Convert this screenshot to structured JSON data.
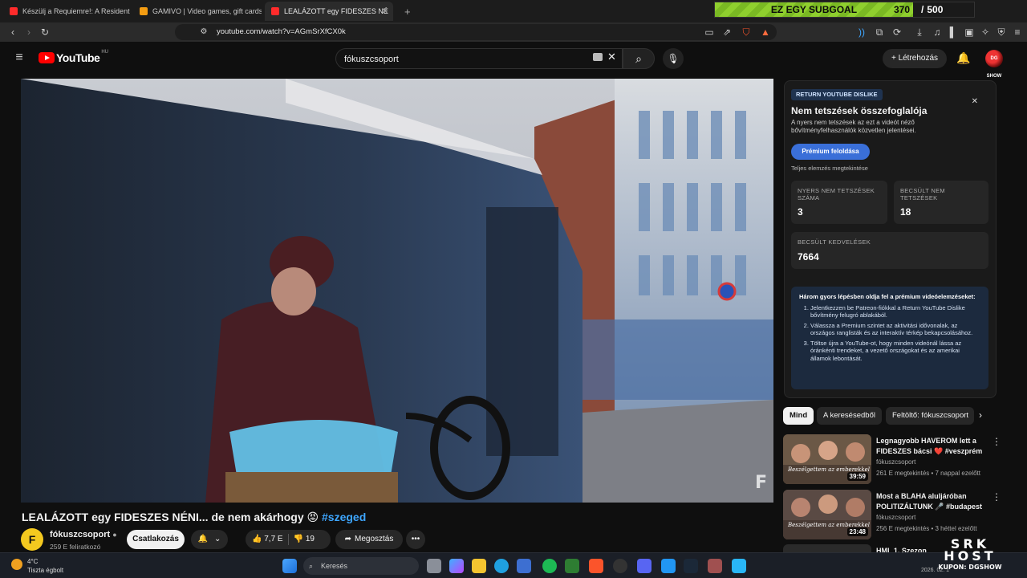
{
  "browser": {
    "tabs": [
      {
        "title": "Készülj a Requiemre!: A Resident Evil",
        "color": "#ff2b2b"
      },
      {
        "title": "GAMIVO | Video games, gift cards, c",
        "color": "#f39c12"
      },
      {
        "title": "LEALÁZOTT egy FIDESZES NÉ",
        "color": "#ff2b2b"
      }
    ],
    "url": "youtube.com/watch?v=AGmSrXfCX0k"
  },
  "subgoal": {
    "label": "EZ EGY SUBGOAL",
    "current": "370",
    "total": "500",
    "progress": 0.74
  },
  "yt": {
    "logo": "YouTube",
    "region": "HU",
    "search_value": "fókuszcsoport",
    "create_label": "Létrehozás",
    "avatar_text": "DG SHOW"
  },
  "video": {
    "title": "LEALÁZOTT egy FIDESZES NÉNI... de nem akárhogy 😡",
    "hashtag": "#szeged",
    "watermark": "F",
    "channel": {
      "name": "fókuszcsoport",
      "initial": "F",
      "subs": "259 E feliratkozó"
    },
    "subscribe_label": "Csatlakozás",
    "likes": "7,7 E",
    "dislikes": "19",
    "share_label": "Megosztás"
  },
  "ryd": {
    "badge": "RETURN YOUTUBE DISLIKE",
    "title": "Nem tetszések összefoglalója",
    "desc": "A nyers nem tetszések az ezt a videót néző bővítményfelhasználók közvetlen jelentései.",
    "premium_btn": "Prémium feloldása",
    "full_analysis": "Teljes elemzés megtekintése",
    "stats": [
      {
        "label": "NYERS NEM TETSZÉSEK SZÁMA",
        "value": "3"
      },
      {
        "label": "BECSÜLT NEM TETSZÉSEK",
        "value": "18"
      },
      {
        "label": "BECSÜLT KEDVELÉSEK",
        "value": "7664"
      }
    ],
    "steps_title": "Három gyors lépésben oldja fel a prémium videóelemzéseket:",
    "steps": [
      "Jelentkezzen be Patreon-fiókkal a Return YouTube Dislike bővítmény felugró ablakából.",
      "Válassza a Premium szintet az aktivitási idővonalak, az országos ranglisták és az interaktív térkép bekapcsolásához.",
      "Töltse újra a YouTube-ot, hogy minden videónál lássa az óránkénti trendeket, a vezető országokat és az amerikai államok lebontását."
    ]
  },
  "chips": [
    "Mind",
    "A keresésedből",
    "Feltöltő: fókuszcsoport"
  ],
  "recs": [
    {
      "title": "Legnagyobb HAVEROM lett a FIDESZES bácsi ❤️ #veszprém",
      "channel": "fókuszcsoport",
      "meta": "261 E megtekintés • 7 nappal ezelőtt",
      "duration": "39:59",
      "thumb_text": "Beszélgettem az emberekkel"
    },
    {
      "title": "Most a BLAHA aluljáróban POLITIZÁLTUNK 🎤 #budapest",
      "channel": "fókuszcsoport",
      "meta": "256 E megtekintés • 3 héttel ezelőtt",
      "duration": "23:48",
      "thumb_text": "Beszélgettem az emberekkel"
    },
    {
      "title": "HML 1. Szezon",
      "channel": "",
      "meta": "",
      "duration": "",
      "thumb_text": ""
    }
  ],
  "taskbar": {
    "temp": "4°C",
    "weather": "Tiszta égbolt",
    "search_placeholder": "Keresés",
    "date_partial": "2026. 02. 1"
  },
  "overlay": {
    "brand_l1": "SRK",
    "brand_l2": "HOST",
    "coupon": "KUPON: DGSHOW"
  }
}
